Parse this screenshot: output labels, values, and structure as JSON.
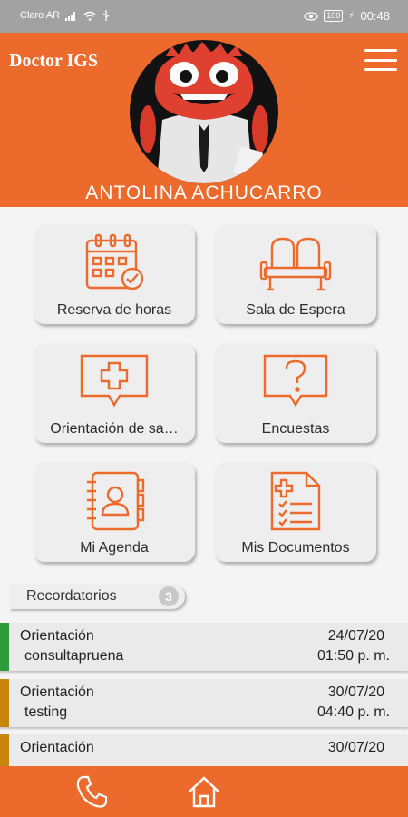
{
  "status_bar": {
    "carrier": "Claro AR",
    "battery": "100",
    "time": "00:48"
  },
  "header": {
    "title": "Doctor IGS",
    "menu_icon": "hamburger-menu-icon",
    "user_name": "ANTOLINA ACHUCARRO"
  },
  "tiles": [
    {
      "label": "Reserva de horas",
      "icon": "calendar-check-icon"
    },
    {
      "label": "Sala de Espera",
      "icon": "waiting-room-seats-icon"
    },
    {
      "label": "Orientación de sa…",
      "icon": "medical-chat-icon"
    },
    {
      "label": "Encuestas",
      "icon": "question-chat-icon"
    },
    {
      "label": "Mi Agenda",
      "icon": "contact-book-icon"
    },
    {
      "label": "Mis Documentos",
      "icon": "medical-document-icon"
    }
  ],
  "reminders": {
    "label": "Recordatorios",
    "count": "3",
    "items": [
      {
        "type": "Orientación",
        "name": "consultapruena",
        "date": "24/07/20",
        "time": "01:50 p. m.",
        "color": "#2e9c3a"
      },
      {
        "type": "Orientación",
        "name": "testing",
        "date": "30/07/20",
        "time": "04:40 p. m.",
        "color": "#c8860c"
      },
      {
        "type": "Orientación",
        "name": "",
        "date": "30/07/20",
        "time": "",
        "color": "#c8860c"
      }
    ]
  },
  "bottom_nav": {
    "items": [
      {
        "icon": "phone-icon"
      },
      {
        "icon": "home-icon"
      }
    ]
  },
  "colors": {
    "brand_orange": "#ec6a2c",
    "tile_bg": "#eeeeee"
  }
}
